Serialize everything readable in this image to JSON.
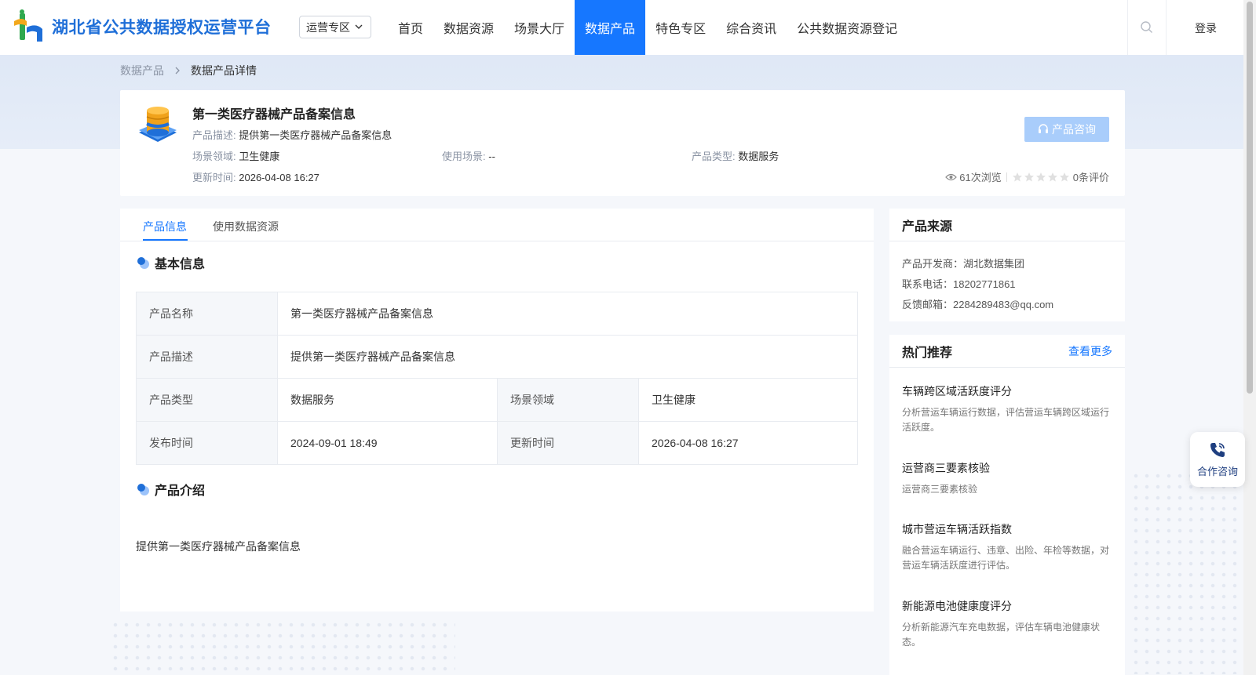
{
  "header": {
    "logo_text": "湖北省公共数据授权运营平台",
    "zone_select": "运营专区",
    "nav": [
      "首页",
      "数据资源",
      "场景大厅",
      "数据产品",
      "特色专区",
      "综合资讯",
      "公共数据资源登记"
    ],
    "active_nav": "数据产品",
    "login": "登录"
  },
  "breadcrumb": {
    "parent": "数据产品",
    "current": "数据产品详情"
  },
  "product": {
    "title": "第一类医疗器械产品备案信息",
    "desc_label": "产品描述:",
    "desc": "提供第一类医疗器械产品备案信息",
    "domain_label": "场景领域:",
    "domain": "卫生健康",
    "usage_label": "使用场景:",
    "usage": "--",
    "type_label": "产品类型:",
    "type": "数据服务",
    "updated_label": "更新时间:",
    "updated": "2026-04-08 16:27",
    "consult_button": "产品咨询",
    "views": "61次浏览",
    "rating_stars": 0,
    "reviews": "0条评价"
  },
  "tabs": {
    "info": "产品信息",
    "resources": "使用数据资源"
  },
  "basic_info": {
    "title": "基本信息",
    "name_label": "产品名称",
    "name": "第一类医疗器械产品备案信息",
    "desc_label": "产品描述",
    "desc": "提供第一类医疗器械产品备案信息",
    "type_label": "产品类型",
    "type": "数据服务",
    "domain_label": "场景领域",
    "domain": "卫生健康",
    "published_label": "发布时间",
    "published": "2024-09-01 18:49",
    "updated_label": "更新时间",
    "updated": "2026-04-08 16:27"
  },
  "intro": {
    "title": "产品介绍",
    "text": "提供第一类医疗器械产品备案信息"
  },
  "source": {
    "title": "产品来源",
    "developer": "产品开发商：湖北数据集团",
    "phone": "联系电话：18202771861",
    "email": "反馈邮箱：2284289483@qq.com"
  },
  "hot": {
    "title": "热门推荐",
    "more": "查看更多",
    "items": [
      {
        "title": "车辆跨区域活跃度评分",
        "desc": "分析营运车辆运行数据，评估营运车辆跨区域运行活跃度。"
      },
      {
        "title": "运营商三要素核验",
        "desc": "运营商三要素核验"
      },
      {
        "title": "城市营运车辆活跃指数",
        "desc": "融合营运车辆运行、违章、出险、年检等数据，对营运车辆活跃度进行评估。"
      },
      {
        "title": "新能源电池健康度评分",
        "desc": "分析新能源汽车充电数据，评估车辆电池健康状态。"
      }
    ]
  },
  "float_consult": "合作咨询",
  "colors": {
    "primary": "#1677ff",
    "button_disabled": "#a9cdfb"
  }
}
